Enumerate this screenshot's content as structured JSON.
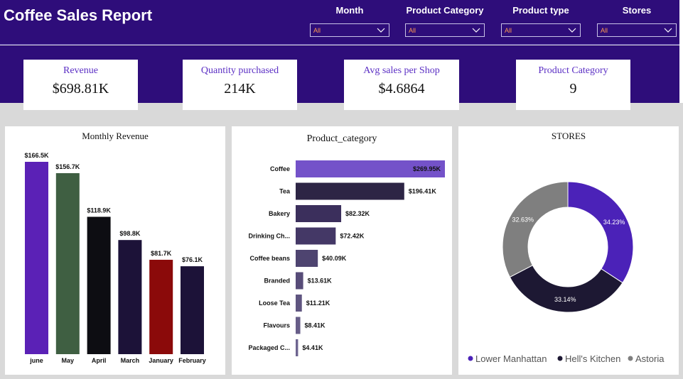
{
  "header": {
    "title": "Coffee Sales Report",
    "filters": [
      {
        "label": "Month",
        "value": "All"
      },
      {
        "label": "Product Category",
        "value": "All"
      },
      {
        "label": "Product type",
        "value": "All"
      },
      {
        "label": "Stores",
        "value": "All"
      }
    ]
  },
  "kpis": [
    {
      "label": "Revenue",
      "value": "$698.81K"
    },
    {
      "label": "Quantity purchased",
      "value": "214K"
    },
    {
      "label": "Avg  sales per Shop",
      "value": "$4.6864"
    },
    {
      "label": "Product Category",
      "value": "9"
    }
  ],
  "chart_data": [
    {
      "type": "bar",
      "title": "Monthly Revenue",
      "categories": [
        "june",
        "May",
        "April",
        "March",
        "January",
        "February"
      ],
      "values": [
        166.5,
        156.7,
        118.9,
        98.8,
        81.7,
        76.1
      ],
      "labels": [
        "$166.5K",
        "$156.7K",
        "$118.9K",
        "$98.8K",
        "$81.7K",
        "$76.1K"
      ],
      "colors": [
        "#5b21b6",
        "#3f5f42",
        "#0d0d12",
        "#1c1238",
        "#8b0a0a",
        "#1c1238"
      ],
      "unit": "K$",
      "ylim": [
        0,
        166.5
      ],
      "grid": false
    },
    {
      "type": "bar",
      "orientation": "horizontal",
      "title": "Product_category",
      "categories": [
        "Coffee",
        "Tea",
        "Bakery",
        "Drinking Ch...",
        "Coffee beans",
        "Branded",
        "Loose Tea",
        "Flavours",
        "Packaged C..."
      ],
      "values": [
        269.95,
        196.41,
        82.32,
        72.42,
        40.09,
        13.61,
        11.21,
        8.41,
        4.41
      ],
      "labels": [
        "$269.95K",
        "$196.41K",
        "$82.32K",
        "$72.42K",
        "$40.09K",
        "$13.61K",
        "$11.21K",
        "$8.41K",
        "$4.41K"
      ],
      "colors": [
        "#7452c9",
        "#2d2545",
        "#3b2f5c",
        "#443866",
        "#4e4470",
        "#574c78",
        "#5f5580",
        "#675d88",
        "#6e6590"
      ],
      "xlim": [
        0,
        269.95
      ],
      "grid": false
    },
    {
      "type": "pie",
      "donut": true,
      "title": "STORES",
      "series": [
        {
          "name": "Lower Manhattan",
          "value": 34.23,
          "label": "34.23%",
          "color": "#4b22b8"
        },
        {
          "name": "Hell's Kitchen",
          "value": 33.14,
          "label": "33.14%",
          "color": "#1d1833"
        },
        {
          "name": "Astoria",
          "value": 32.63,
          "label": "32.63%",
          "color": "#7f7f7f"
        }
      ],
      "legend": "bottom"
    }
  ]
}
